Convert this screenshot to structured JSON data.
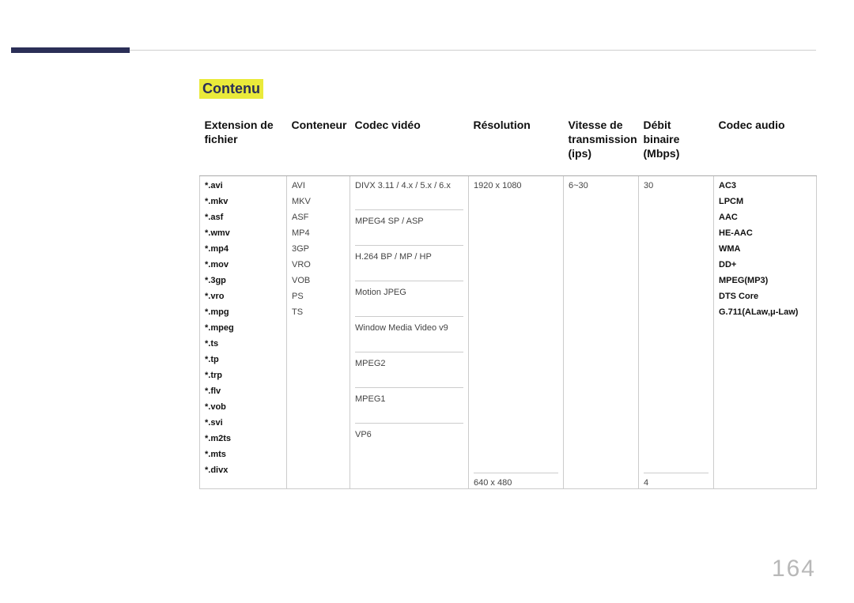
{
  "section_title": "Contenu",
  "page_number": "164",
  "columns": {
    "ext": "Extension de fichier",
    "container": "Conteneur",
    "vcodec": "Codec vidéo",
    "resolution": "Résolution",
    "framerate": "Vitesse de transmission (ips)",
    "bitrate": "Débit binaire (Mbps)",
    "acodec": "Codec audio"
  },
  "extensions": [
    "*.avi",
    "*.mkv",
    "*.asf",
    "*.wmv",
    "*.mp4",
    "*.mov",
    "*.3gp",
    "*.vro",
    "*.mpg",
    "*.mpeg",
    "*.ts",
    "*.tp",
    "*.trp",
    "*.flv",
    "*.vob",
    "*.svi",
    "*.m2ts",
    "*.mts",
    "*.divx"
  ],
  "containers": [
    "AVI",
    "MKV",
    "ASF",
    "MP4",
    "3GP",
    "VRO",
    "VOB",
    "PS",
    "TS"
  ],
  "video_codecs": [
    "DIVX 3.11 / 4.x / 5.x / 6.x",
    "MPEG4 SP / ASP",
    "H.264 BP / MP / HP",
    "Motion JPEG",
    "Window Media Video v9",
    "MPEG2",
    "MPEG1",
    "VP6"
  ],
  "resolutions": {
    "top": "1920 x 1080",
    "bot": "640 x 480"
  },
  "framerate_val": "6~30",
  "bitrates": {
    "top": "30",
    "bot": "4"
  },
  "audio_codecs": [
    "AC3",
    "LPCM",
    "AAC",
    "HE-AAC",
    "WMA",
    "DD+",
    "MPEG(MP3)",
    "DTS Core",
    "G.711(ALaw,μ-Law)"
  ]
}
